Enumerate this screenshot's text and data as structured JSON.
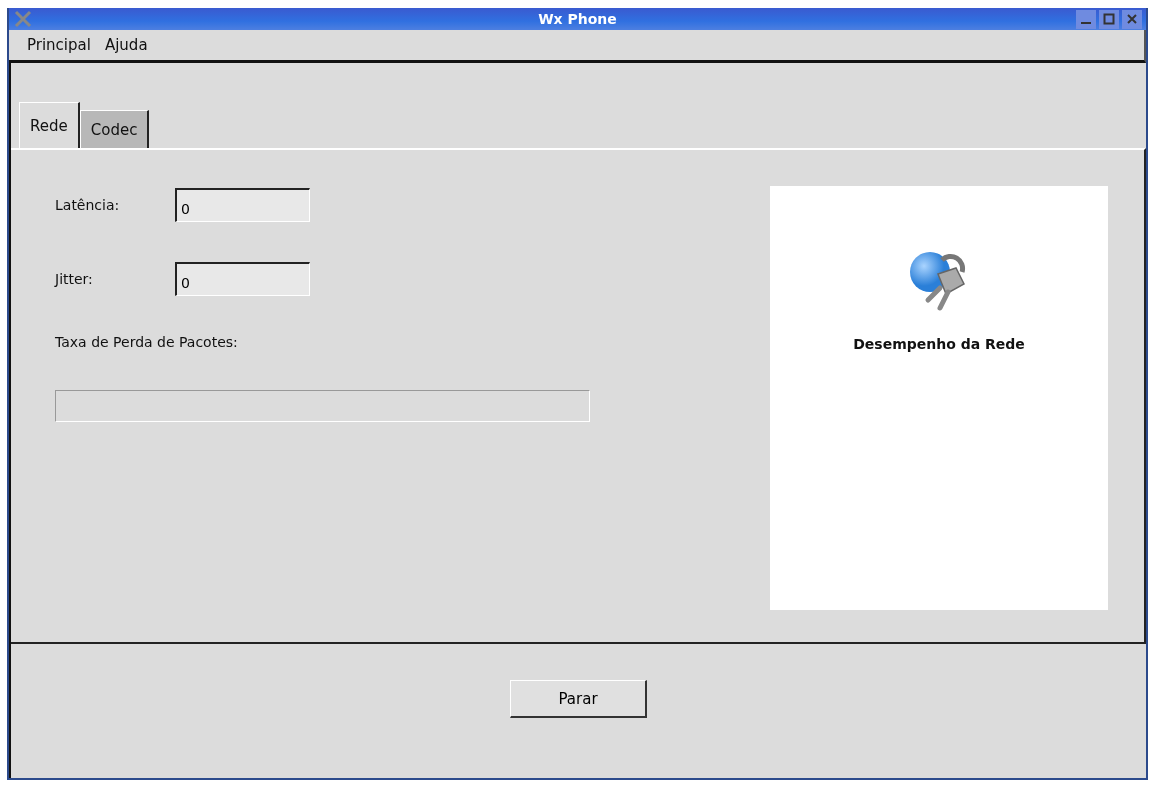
{
  "window": {
    "title": "Wx Phone"
  },
  "menu": [
    "Principal",
    "Ajuda"
  ],
  "tabs": [
    {
      "label": "Rede",
      "selected": true
    },
    {
      "label": "Codec",
      "selected": false
    }
  ],
  "fields": [
    {
      "label": "Latência:",
      "value": "0"
    },
    {
      "label": "Jitter:",
      "value": "0"
    }
  ],
  "packet_loss": {
    "label": "Taxa de Perda de Pacotes:",
    "level": 0
  },
  "side_panel": {
    "caption": "Desempenho da Rede"
  },
  "buttons": [
    "Parar"
  ]
}
